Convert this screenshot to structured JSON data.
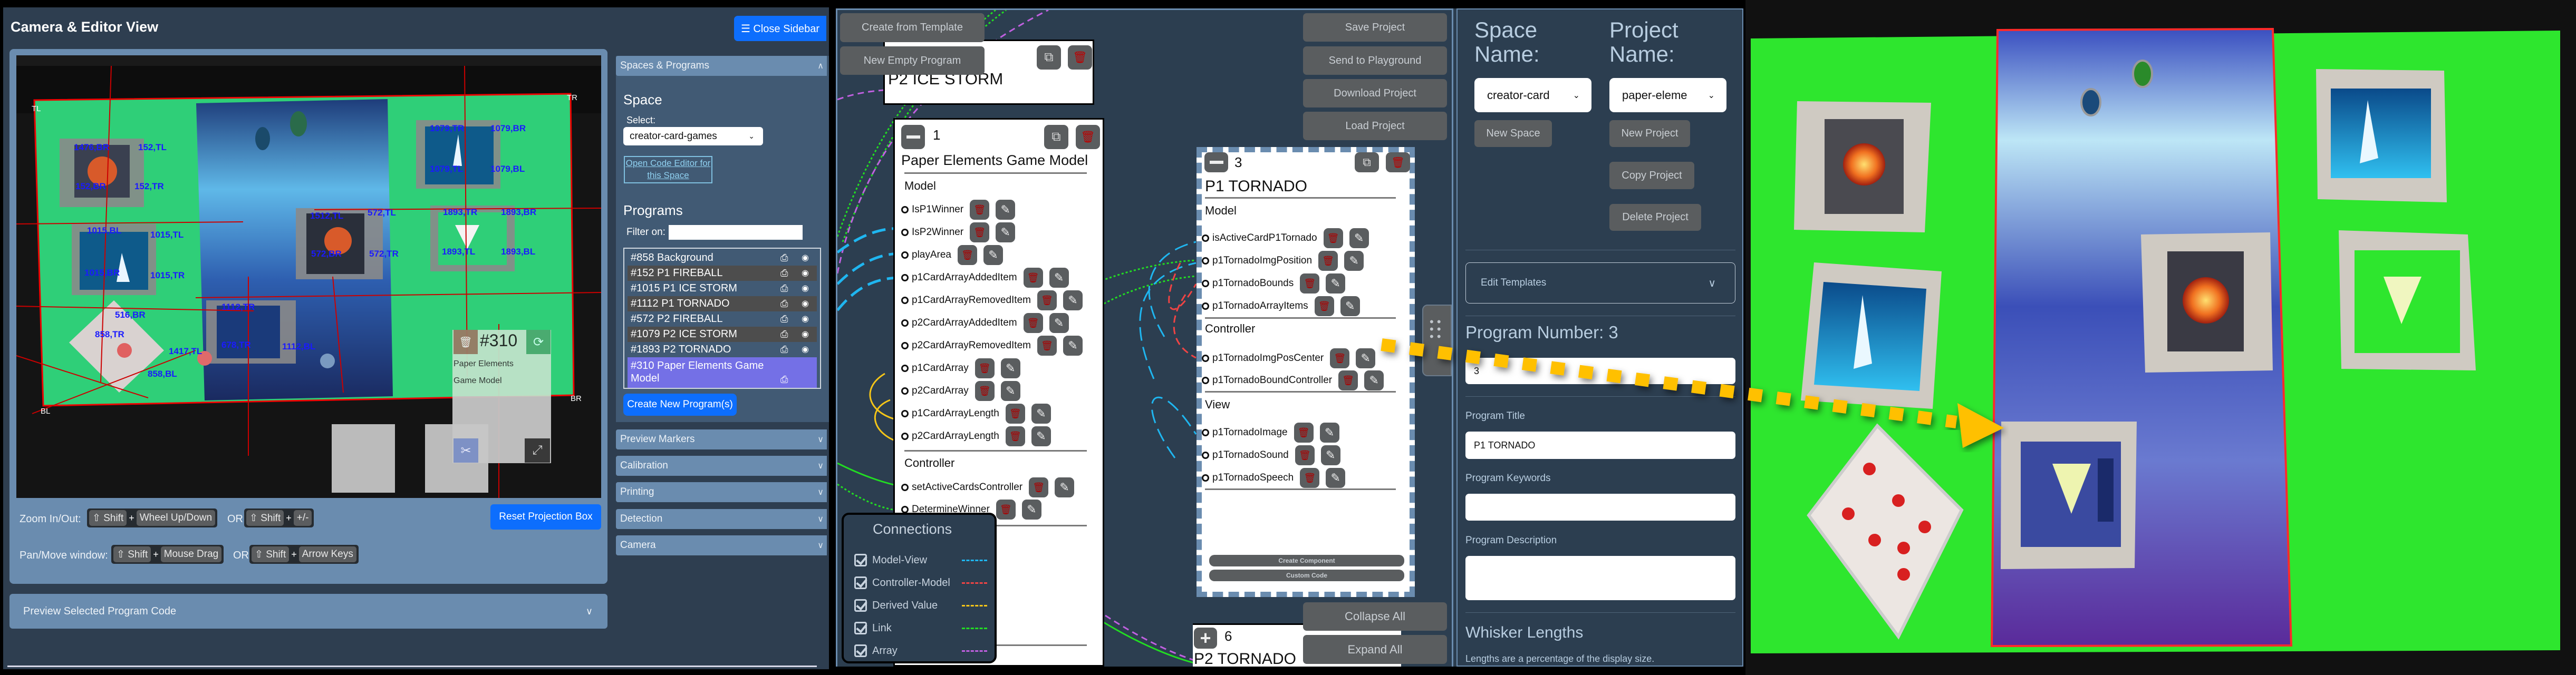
{
  "camera_view": {
    "title": "Camera & Editor View",
    "close_sidebar_label": "☰ Close Sidebar",
    "corner_labels": [
      "TL",
      "TR",
      "BL",
      "BR"
    ],
    "marker_labels": [
      "1476,BR",
      "152,TL",
      "152,BR",
      "152,TR",
      "1079,TR",
      "1079,BR",
      "1079,TL",
      "1079,BL",
      "1512,TL",
      "572,TL",
      "572,BR",
      "572,TR",
      "1893,TR",
      "1893,BR",
      "1893,TL",
      "1893,BL",
      "1015,BL",
      "1015,TL",
      "1015,BR",
      "1015,TR",
      "1112,TR",
      "516,BR",
      "858,TR",
      "1417,TL",
      "678,TR",
      "1112,BL",
      "858,BL"
    ],
    "program_overlay": {
      "number": "#310",
      "line1": "Paper Elements",
      "line2": "Game Model"
    },
    "controls": {
      "zoom_label": "Zoom In/Out:",
      "zoom_keys_a": [
        "⇧ Shift",
        "Wheel Up/Down"
      ],
      "zoom_keys_b": [
        "⇧ Shift",
        "+/-"
      ],
      "pan_label": "Pan/Move window:",
      "pan_keys_a": [
        "⇧ Shift",
        "Mouse Drag"
      ],
      "pan_keys_b": [
        "⇧ Shift",
        "Arrow Keys"
      ],
      "plus": "+",
      "or": "OR"
    },
    "reset_projection_label": "Reset Projection Box",
    "preview_code_label": "Preview Selected Program Code"
  },
  "sidebar": {
    "spaces_programs_header": "Spaces & Programs",
    "space_heading": "Space",
    "select_label": "Select:",
    "space_selected": "creator-card-games",
    "open_code_editor": "Open Code Editor for this Space",
    "programs_heading": "Programs",
    "filter_label": "Filter on:",
    "filter_value": "",
    "programs": [
      {
        "label": "#858 Background",
        "visible_toggle": true
      },
      {
        "label": "#152 P1 FIREBALL",
        "visible_toggle": true
      },
      {
        "label": "#1015 P1 ICE STORM",
        "visible_toggle": true
      },
      {
        "label": "#1112 P1 TORNADO",
        "visible_toggle": true
      },
      {
        "label": "#572 P2 FIREBALL",
        "visible_toggle": true
      },
      {
        "label": "#1079 P2 ICE STORM",
        "visible_toggle": true
      },
      {
        "label": "#1893 P2 TORNADO",
        "visible_toggle": true
      },
      {
        "label": "#310 Paper Elements Game Model",
        "visible_toggle": false,
        "selected": true
      }
    ],
    "create_program_label": "Create New Program(s)",
    "accordions": [
      "Preview Markers",
      "Calibration",
      "Printing",
      "Detection",
      "Camera"
    ]
  },
  "editor": {
    "create_from_template": "Create from Template",
    "new_empty_program": "New Empty Program",
    "project_buttons": [
      "Save Project",
      "Send to Playground",
      "Download Project",
      "Load Project"
    ],
    "collapse_all": "Collapse All",
    "expand_all": "Expand All",
    "card_top": {
      "title": "P2 ICE STORM"
    },
    "card_model": {
      "number": "1",
      "title": "Paper Elements Game Model",
      "model_heading": "Model",
      "model_items": [
        "IsP1Winner",
        "IsP2Winner",
        "playArea",
        "p1CardArrayAddedItem",
        "p1CardArrayRemovedItem",
        "p2CardArrayAddedItem",
        "p2CardArrayRemovedItem",
        "p1CardArray",
        "p2CardArray",
        "p1CardArrayLength",
        "p2CardArrayLength"
      ],
      "controller_heading": "Controller",
      "controller_items": [
        "setActiveCardsController",
        "DetermineWinner"
      ]
    },
    "card_selected": {
      "number": "3",
      "title": "P1 TORNADO",
      "model_heading": "Model",
      "model_items": [
        "isActiveCardP1Tornado",
        "p1TornadoImgPosition",
        "p1TornadoBounds",
        "p1TornadoArrayItems"
      ],
      "controller_heading": "Controller",
      "controller_items": [
        "p1TornadoImgPosCenter",
        "p1TornadoBoundController"
      ],
      "view_heading": "View",
      "view_items": [
        "p1TornadoImage",
        "p1TornadoSound",
        "p1TornadoSpeech"
      ],
      "create_component": "Create Component",
      "custom_code": "Custom Code"
    },
    "card_bottom": {
      "number": "6",
      "title": "P2 TORNADO"
    },
    "connections": {
      "title": "Connections",
      "items": [
        {
          "label": "Model-View",
          "checked": true,
          "color": "#1fb6f0"
        },
        {
          "label": "Controller-Model",
          "checked": true,
          "color": "#f04444"
        },
        {
          "label": "Derived Value",
          "checked": true,
          "color": "#f5c518"
        },
        {
          "label": "Link",
          "checked": true,
          "color": "#22dd22"
        },
        {
          "label": "Array",
          "checked": true,
          "color": "#c060e0"
        }
      ]
    }
  },
  "properties": {
    "space_name_label": "Space Name:",
    "project_name_label": "Project Name:",
    "space_select": "creator-card",
    "project_select": "paper-eleme",
    "new_space": "New Space",
    "new_project": "New Project",
    "copy_project": "Copy Project",
    "delete_project": "Delete Project",
    "edit_templates": "Edit Templates",
    "program_number_heading": "Program Number: 3",
    "program_number_value": "3",
    "program_title_label": "Program Title",
    "program_title_value": "P1 TORNADO",
    "program_keywords_label": "Program Keywords",
    "program_keywords_value": "",
    "program_description_label": "Program Description",
    "program_description_value": "",
    "whisker_heading": "Whisker Lengths",
    "whisker_note": "Lengths are a percentage of the display size."
  },
  "colors": {
    "accent_blue": "#0d6efd",
    "selected_program": "#7470e6",
    "annotation_arrow": "#ffc000",
    "projection_green": "#2ee62e"
  }
}
